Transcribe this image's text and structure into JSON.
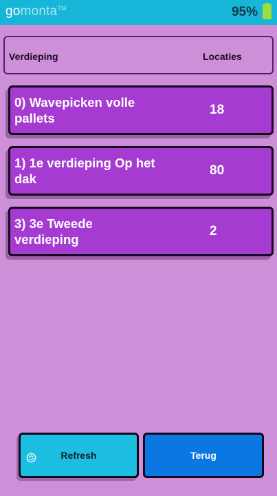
{
  "status_bar": {
    "logo_go": "go",
    "logo_monta": "monta",
    "logo_tm": "TM",
    "battery_percent": "95%",
    "battery_icon": "battery-icon",
    "color": "#17b6d8"
  },
  "table_header": {
    "floor_label": "Verdieping",
    "locations_label": "Locaties"
  },
  "rows": [
    {
      "label": "0) Wavepicken volle pallets",
      "count": "18"
    },
    {
      "label": "1) 1e verdieping  Op het dak",
      "count": "80"
    },
    {
      "label": "3) 3e Tweede verdieping",
      "count": "2"
    }
  ],
  "buttons": {
    "refresh_label": "Refresh",
    "refresh_icon": "refresh-icon",
    "back_label": "Terug"
  },
  "colors": {
    "background": "#cc8fd8",
    "row": "#a63bd1",
    "refresh_button": "#1bbee0",
    "back_button": "#0b77e2"
  }
}
